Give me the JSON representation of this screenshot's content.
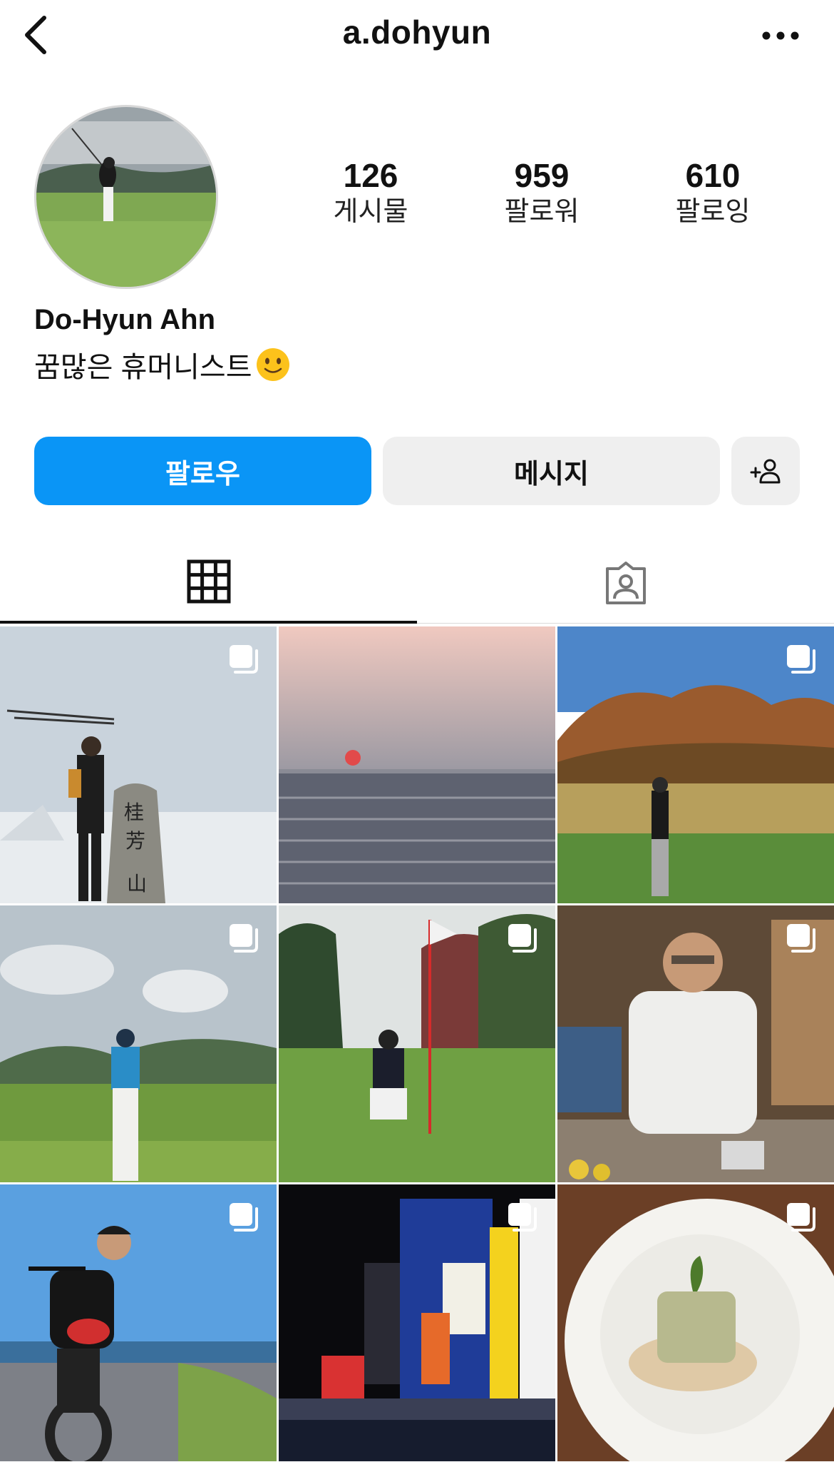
{
  "header": {
    "title": "a.dohyun",
    "back_icon": "chevron-left-icon",
    "more_icon": "more-horizontal-icon"
  },
  "profile": {
    "stats": [
      {
        "value": "126",
        "label": "게시물"
      },
      {
        "value": "959",
        "label": "팔로워"
      },
      {
        "value": "610",
        "label": "팔로잉"
      }
    ],
    "name": "Do-Hyun Ahn",
    "bio": "꿈많은 휴머니스트",
    "bio_emoji": "slightly-smiling-face-emoji"
  },
  "actions": {
    "follow_label": "팔로우",
    "message_label": "메시지",
    "add_person_icon": "add-person-icon",
    "follow_color": "#0a95f6"
  },
  "tabs": [
    {
      "name": "posts-grid",
      "icon": "grid-icon",
      "active": true
    },
    {
      "name": "tagged",
      "icon": "tagged-person-icon",
      "active": false
    }
  ],
  "posts": [
    {
      "subject": "hiker with poles at snowy summit stone",
      "multi": true
    },
    {
      "subject": "sunset over sea",
      "multi": false
    },
    {
      "subject": "golfer on autumn course",
      "multi": true
    },
    {
      "subject": "golfer in blue shirt with mountains",
      "multi": true
    },
    {
      "subject": "golfer crouching by flag",
      "multi": true
    },
    {
      "subject": "chef preparing food",
      "multi": true
    },
    {
      "subject": "man on fat-tire bike by sea",
      "multi": true
    },
    {
      "subject": "city neon billboards at night",
      "multi": true
    },
    {
      "subject": "plated dish on white plate",
      "multi": true
    }
  ]
}
